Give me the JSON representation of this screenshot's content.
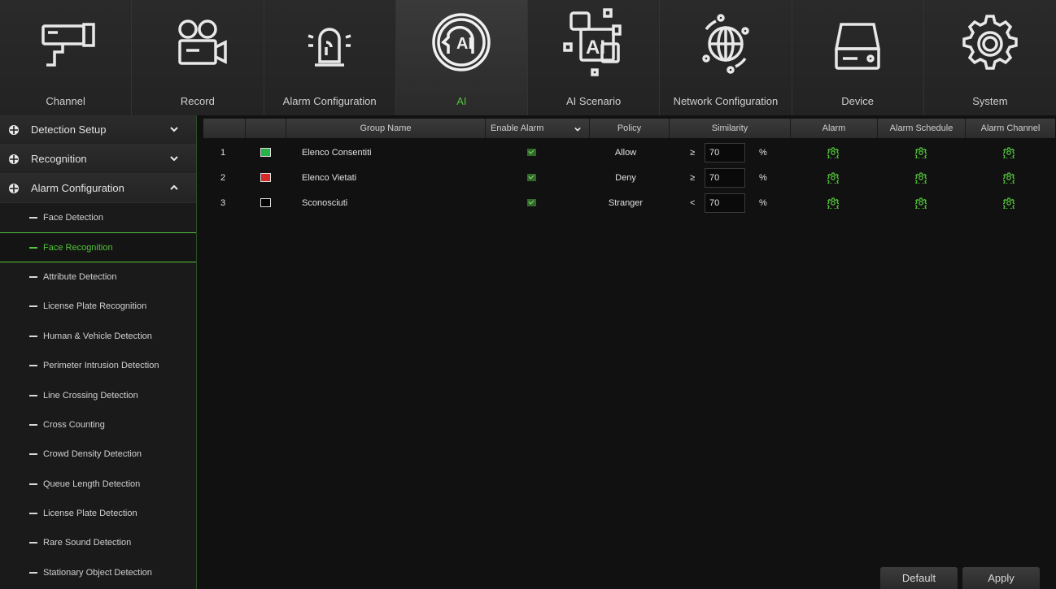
{
  "nav": [
    {
      "label": "Channel",
      "icon": "camera-icon"
    },
    {
      "label": "Record",
      "icon": "video-camera-icon"
    },
    {
      "label": "Alarm Configuration",
      "icon": "siren-icon"
    },
    {
      "label": "AI",
      "icon": "ai-head-icon",
      "active": true
    },
    {
      "label": "AI Scenario",
      "icon": "ai-scenario-icon"
    },
    {
      "label": "Network Configuration",
      "icon": "globe-icon"
    },
    {
      "label": "Device",
      "icon": "hdd-device-icon"
    },
    {
      "label": "System",
      "icon": "gear-icon"
    }
  ],
  "sidebar": {
    "sections": [
      {
        "label": "Detection Setup",
        "icon": "pin-icon",
        "expanded": false
      },
      {
        "label": "Recognition",
        "icon": "pin-icon",
        "expanded": false
      },
      {
        "label": "Alarm Configuration",
        "icon": "pin-icon",
        "expanded": true
      }
    ],
    "items": [
      "Face Detection",
      "Face Recognition",
      "Attribute Detection",
      "License Plate Recognition",
      "Human & Vehicle Detection",
      "Perimeter Intrusion Detection",
      "Line Crossing Detection",
      "Cross Counting",
      "Crowd Density Detection",
      "Queue Length Detection",
      "License Plate Detection",
      "Rare Sound Detection",
      "Stationary Object Detection"
    ],
    "active_item": "Face Recognition"
  },
  "table": {
    "headers": {
      "group_name": "Group Name",
      "enable_alarm": "Enable Alarm",
      "policy": "Policy",
      "similarity": "Similarity",
      "alarm": "Alarm",
      "alarm_schedule": "Alarm Schedule",
      "alarm_channel": "Alarm Channel"
    },
    "rows": [
      {
        "index": "1",
        "color": "#27b24a",
        "name": "Elenco Consentiti",
        "enabled": true,
        "policy": "Allow",
        "operator": "≥",
        "similarity": "70",
        "unit": "%"
      },
      {
        "index": "2",
        "color": "#d42a2a",
        "name": "Elenco Vietati",
        "enabled": true,
        "policy": "Deny",
        "operator": "≥",
        "similarity": "70",
        "unit": "%"
      },
      {
        "index": "3",
        "color": "#000000",
        "name": "Sconosciuti",
        "enabled": true,
        "policy": "Stranger",
        "operator": "<",
        "similarity": "70",
        "unit": "%"
      }
    ]
  },
  "buttons": {
    "default": "Default",
    "apply": "Apply"
  },
  "colors": {
    "accent": "#52c33a",
    "background": "#111111"
  }
}
